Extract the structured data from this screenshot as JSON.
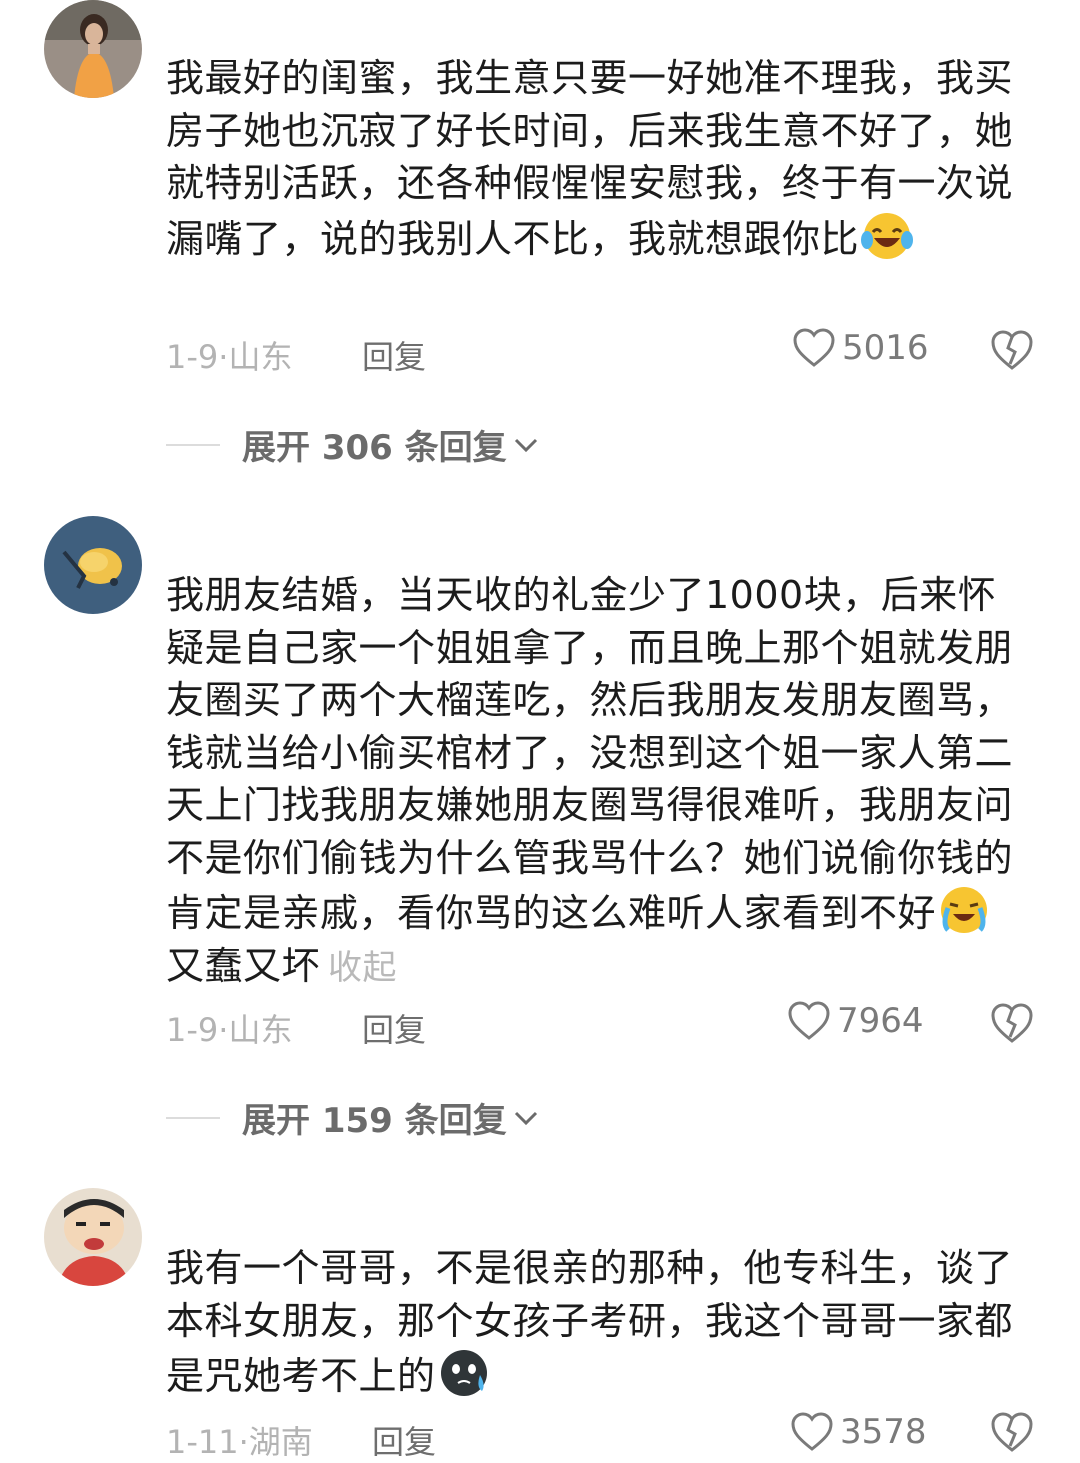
{
  "comments": [
    {
      "text": "我最好的闺蜜，我生意只要一好她准不理我，我买房子她也沉寂了好长时间，后来我生意不好了，她就特别活跃，还各种假惺惺安慰我，终于有一次说漏嘴了，说的我别人不比，我就想跟你比",
      "emoji": "laughing-crying-emoji",
      "date": "1-9·",
      "location": "山东",
      "reply_label": "回复",
      "likes": "5016",
      "expand_label": "展开 306 条回复"
    },
    {
      "text": "我朋友结婚，当天收的礼金少了1000块，后来怀疑是自己家一个姐姐拿了，而且晚上那个姐就发朋友圈买了两个大榴莲吃，然后我朋友发朋友圈骂，钱就当给小偷买棺材了，没想到这个姐一家人第二天上门找我朋友嫌她朋友圈骂得很难听，我朋友问不是你们偷钱为什么管我骂什么？她们说偷你钱的肯定是亲戚，看你骂的这么难听人家看到不好",
      "text_after": "又蠢又坏",
      "collapse_label": "收起",
      "emoji": "crying-laughing-emoji",
      "date": "1-9·",
      "location": "山东",
      "reply_label": "回复",
      "likes": "7964",
      "expand_label": "展开 159 条回复"
    },
    {
      "text": "我有一个哥哥，不是很亲的那种，他专科生，谈了本科女朋友，那个女孩子考研，我这个哥哥一家都是咒她考不上的",
      "emoji": "dark-sweat-emoji",
      "date": "1-11·",
      "location": "湖南",
      "reply_label": "回复",
      "likes": "3578"
    }
  ],
  "colors": {
    "meta": "#b3b3b3",
    "reply": "#6e6e6e",
    "text": "#1c1c1c"
  }
}
